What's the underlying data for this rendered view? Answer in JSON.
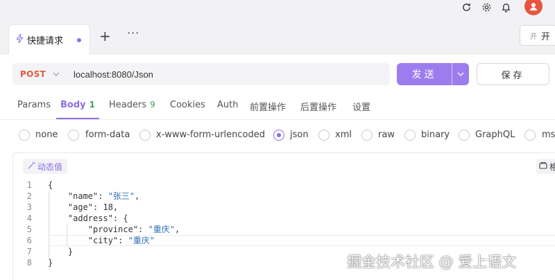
{
  "tabs": [
    {
      "label": "快捷请求",
      "icon": "bolt-icon",
      "unsaved": true
    }
  ],
  "tab_actions": {
    "add": "+",
    "more": "···"
  },
  "open_button": {
    "icon_label": "开",
    "label": "开"
  },
  "request": {
    "method": "POST",
    "url": "localhost:8080/Json",
    "send_label": "发送",
    "save_label": "保存"
  },
  "subtabs": [
    {
      "label": "Params",
      "count": ""
    },
    {
      "label": "Body",
      "count": "1"
    },
    {
      "label": "Headers",
      "count": "9"
    },
    {
      "label": "Cookies",
      "count": ""
    },
    {
      "label": "Auth",
      "count": ""
    },
    {
      "label": "前置操作",
      "count": ""
    },
    {
      "label": "后置操作",
      "count": ""
    },
    {
      "label": "设置",
      "count": ""
    }
  ],
  "body_types": [
    {
      "label": "none",
      "checked": false
    },
    {
      "label": "form-data",
      "checked": false
    },
    {
      "label": "x-www-form-urlencoded",
      "checked": false
    },
    {
      "label": "json",
      "checked": true
    },
    {
      "label": "xml",
      "checked": false
    },
    {
      "label": "raw",
      "checked": false
    },
    {
      "label": "binary",
      "checked": false
    },
    {
      "label": "GraphQL",
      "checked": false
    },
    {
      "label": "msg",
      "checked": false
    }
  ],
  "editor": {
    "dynamic_value_label": "动态值",
    "format_label": "格",
    "lines": [
      {
        "num": "1",
        "text": "{"
      },
      {
        "num": "2",
        "text": "    \"name\": \"张三\","
      },
      {
        "num": "3",
        "text": "    \"age\": 18,"
      },
      {
        "num": "4",
        "text": "    \"address\": {"
      },
      {
        "num": "5",
        "text": "        \"province\": \"重庆\","
      },
      {
        "num": "6",
        "text": "        \"city\": \"重庆\""
      },
      {
        "num": "7",
        "text": "    }"
      },
      {
        "num": "8",
        "text": "}"
      }
    ]
  },
  "watermark": "掘金技术社区 @ 爱上语文",
  "colors": {
    "accent": "#9c7ded",
    "method": "#e05b3e",
    "count": "#3aa35a",
    "string": "#2f6fb5"
  }
}
